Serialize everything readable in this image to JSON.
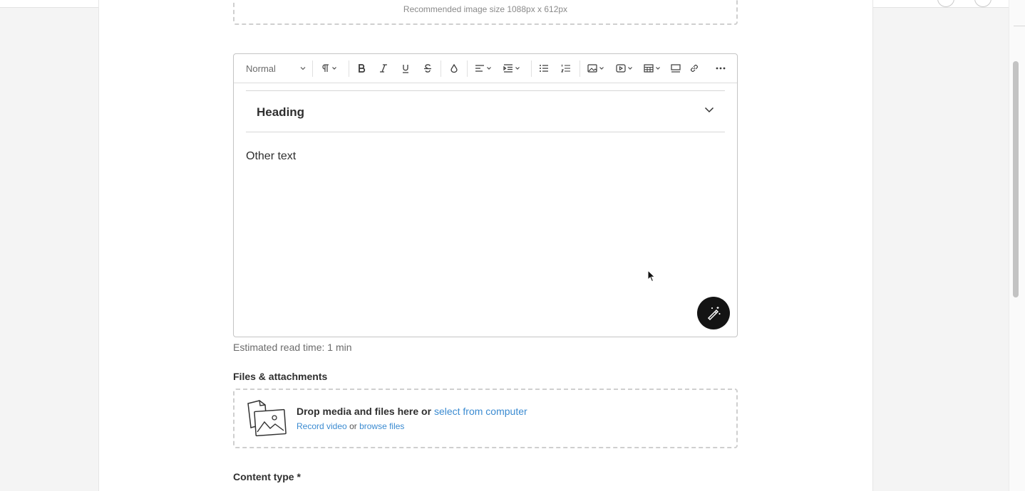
{
  "image_upload": {
    "hint": "Recommended image size 1088px x 612px"
  },
  "editor": {
    "toolbar": {
      "text_style": "Normal",
      "buttons": [
        "paragraph-format",
        "bold",
        "italic",
        "underline",
        "strikethrough",
        "text-color",
        "align",
        "indent",
        "bulleted-list",
        "numbered-list",
        "insert-image",
        "insert-video",
        "insert-table",
        "horizontal-line",
        "insert-link",
        "more"
      ]
    },
    "collapsible_heading": "Heading",
    "body_text": "Other text"
  },
  "read_time": "Estimated read time: 1 min",
  "files": {
    "label": "Files & attachments",
    "drop_text": "Drop media and files here or",
    "select_link": "select from computer",
    "record_link": "Record video",
    "or_text": "or",
    "browse_link": "browse files"
  },
  "content_type": {
    "label": "Content type *"
  },
  "colors": {
    "link": "#3b8bd1",
    "fab": "#141414"
  }
}
